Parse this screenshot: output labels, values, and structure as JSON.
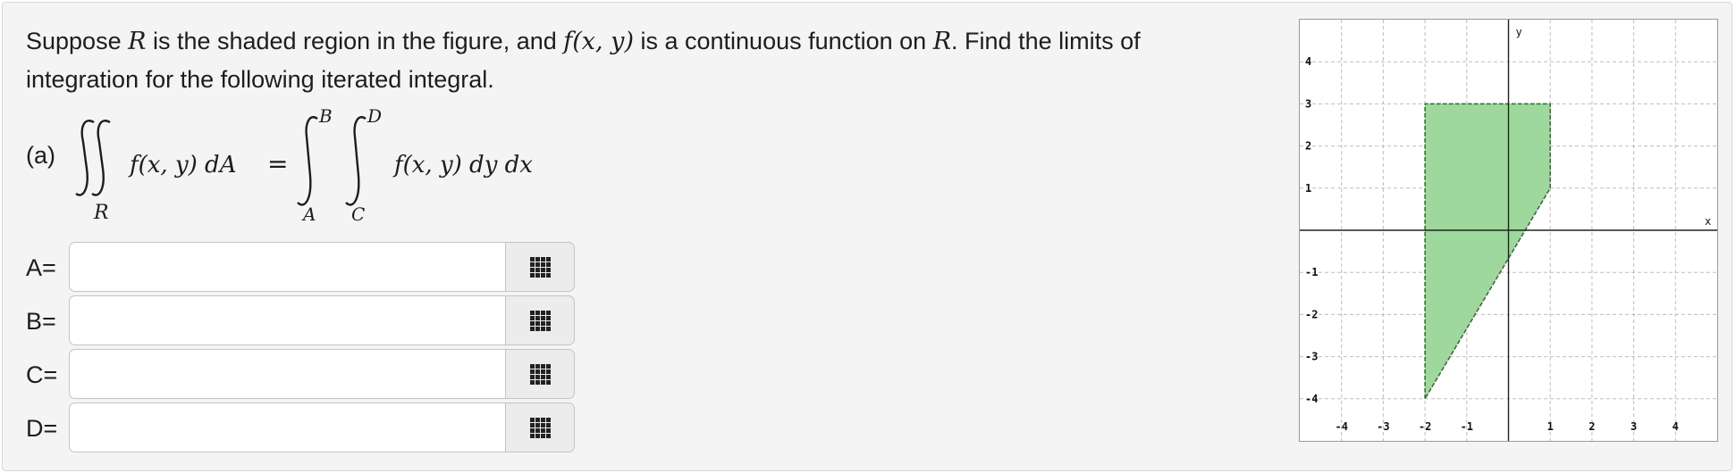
{
  "problem": {
    "intro_1": "Suppose ",
    "region_symbol": "R",
    "intro_2": " is the shaded region in the figure, and ",
    "function_expr": "f(x, y)",
    "intro_3": " is a continuous function on ",
    "intro_4": ". Find the limits of integration for the following iterated integral."
  },
  "part": {
    "label": "(a)",
    "lhs_integrand": "f(x, y) dA",
    "equals": "=",
    "region_subscript": "R",
    "outer_upper": "B",
    "outer_lower": "A",
    "inner_upper": "D",
    "inner_lower": "C",
    "rhs_integrand": "f(x, y) dy dx"
  },
  "fields": [
    {
      "label": "A=",
      "value": ""
    },
    {
      "label": "B=",
      "value": ""
    },
    {
      "label": "C=",
      "value": ""
    },
    {
      "label": "D=",
      "value": ""
    }
  ],
  "graph": {
    "x_axis_label": "x",
    "y_axis_label": "y",
    "x_range": [
      -5,
      5
    ],
    "y_range": [
      -5,
      5
    ],
    "x_ticks": [
      "-4",
      "-3",
      "-2",
      "-1",
      "1",
      "2",
      "3",
      "4"
    ],
    "y_ticks": [
      "4",
      "3",
      "2",
      "1",
      "-1",
      "-2",
      "-3",
      "-4"
    ],
    "region_vertices": [
      [
        -2,
        -4
      ],
      [
        -2,
        3
      ],
      [
        1,
        3
      ],
      [
        1,
        1
      ]
    ],
    "fill_color": "#9fd89d",
    "edge_color": "#2f6b2f",
    "grid_color": "#bdbdbd"
  }
}
